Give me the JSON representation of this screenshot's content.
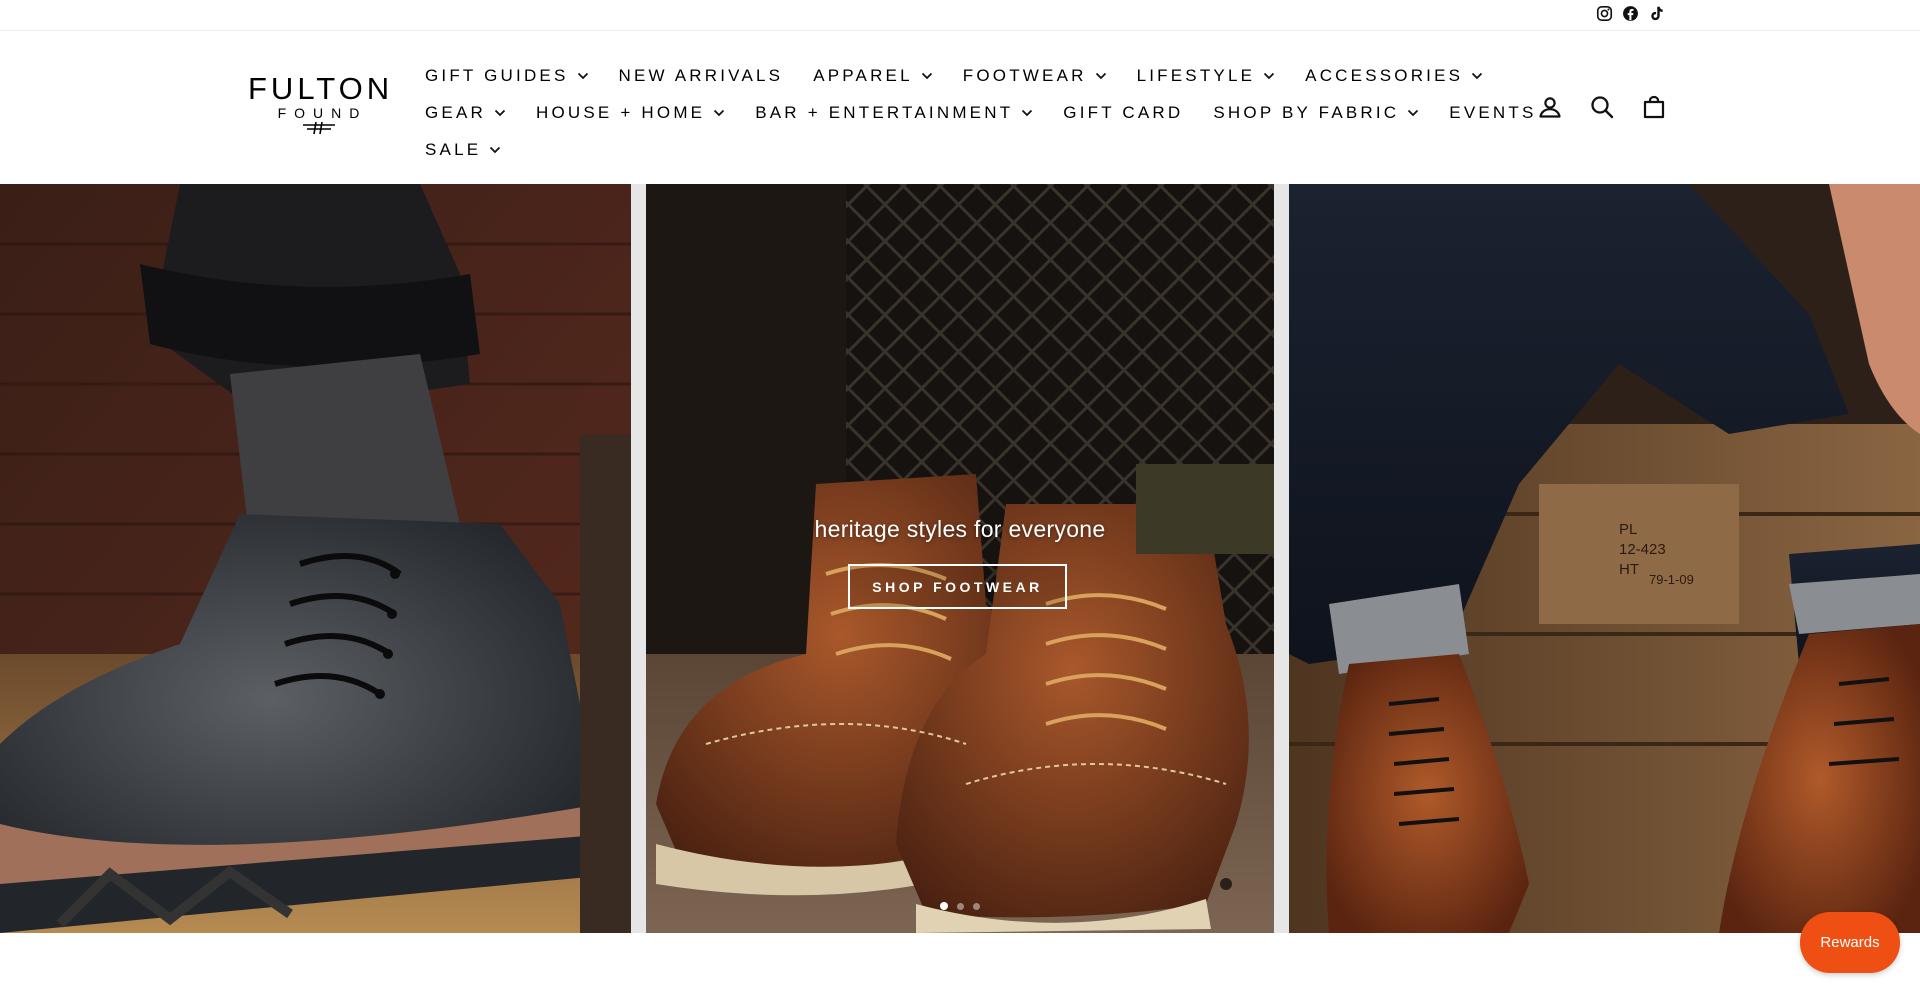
{
  "social": {
    "icons": [
      "instagram-icon",
      "facebook-icon",
      "tiktok-icon"
    ]
  },
  "brand": {
    "name": "FULTON",
    "sub": "FOUND"
  },
  "nav": {
    "row1": [
      {
        "label": "GIFT GUIDES",
        "dropdown": true
      },
      {
        "label": "NEW ARRIVALS",
        "dropdown": false
      },
      {
        "label": "APPAREL",
        "dropdown": true
      },
      {
        "label": "FOOTWEAR",
        "dropdown": true
      },
      {
        "label": "LIFESTYLE",
        "dropdown": true
      },
      {
        "label": "ACCESSORIES",
        "dropdown": true
      }
    ],
    "row2": [
      {
        "label": "GEAR",
        "dropdown": true
      },
      {
        "label": "HOUSE + HOME",
        "dropdown": true
      },
      {
        "label": "BAR + ENTERTAINMENT",
        "dropdown": true
      },
      {
        "label": "GIFT CARD",
        "dropdown": false
      },
      {
        "label": "SHOP BY FABRIC",
        "dropdown": true
      },
      {
        "label": "EVENTS",
        "dropdown": false
      }
    ],
    "row3": [
      {
        "label": "SALE",
        "dropdown": true
      }
    ]
  },
  "header_icons": [
    "account-icon",
    "search-icon",
    "cart-icon"
  ],
  "hero": {
    "tagline": "heritage styles for everyone",
    "cta": "SHOP FOOTWEAR",
    "slides": 3,
    "active_slide": 1
  },
  "rewards": {
    "label": "Rewards"
  },
  "colors": {
    "rewards_bg": "#ef4f12",
    "text": "#000000"
  }
}
